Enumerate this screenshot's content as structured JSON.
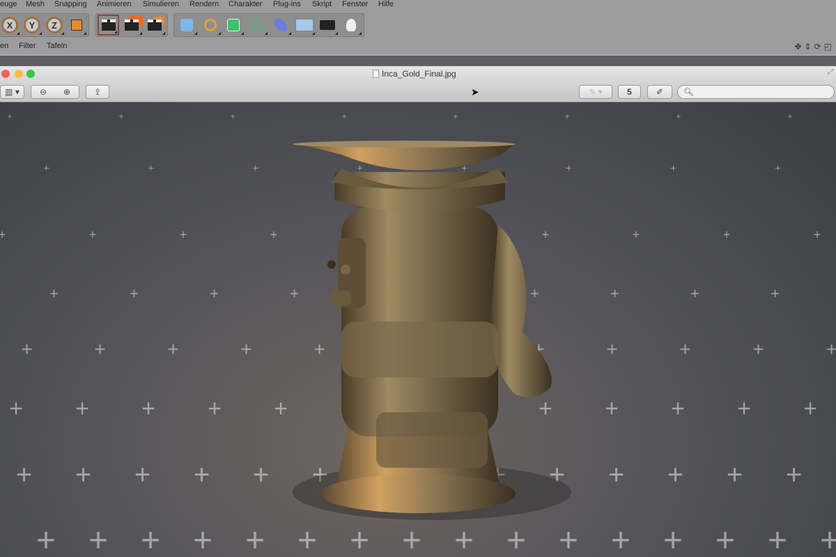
{
  "menu": [
    "euge",
    "Mesh",
    "Snapping",
    "Animieren",
    "Simulieren",
    "Rendern",
    "Charakter",
    "Plug-ins",
    "Skript",
    "Fenster",
    "Hilfe"
  ],
  "axes": [
    "X",
    "Y",
    "Z"
  ],
  "submenu": [
    "en",
    "Filter",
    "Tafeln"
  ],
  "preview": {
    "title": "Inca_Gold_Final.jpg",
    "search_placeholder": "",
    "rotate_label": "5"
  },
  "colors": {
    "close": "#fc605b",
    "minimize": "#fdbc40",
    "zoom": "#34c84a",
    "gold": "#8a7350"
  }
}
